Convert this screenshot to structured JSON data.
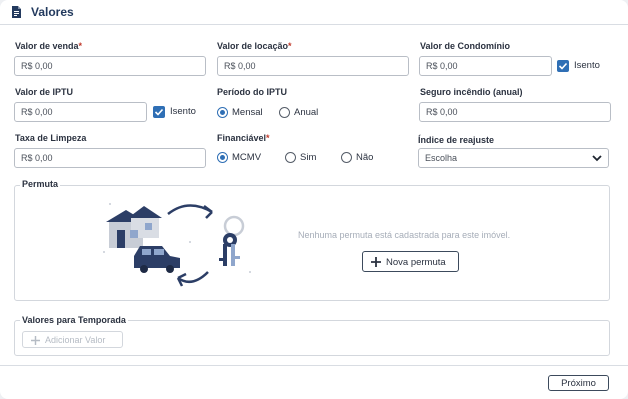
{
  "header": {
    "title": "Valores",
    "icon": "document-icon"
  },
  "fields": {
    "valor_venda": {
      "label": "Valor de venda",
      "required": "*",
      "value": "R$ 0,00"
    },
    "valor_locacao": {
      "label": "Valor de locação",
      "required": "*",
      "value": "R$ 0,00"
    },
    "valor_condominio": {
      "label": "Valor de Condomínio",
      "value": "R$ 0,00",
      "isento_label": "Isento",
      "isento_checked": true
    },
    "valor_iptu": {
      "label": "Valor de IPTU",
      "value": "R$ 0,00",
      "isento_label": "Isento",
      "isento_checked": true
    },
    "periodo_iptu": {
      "label": "Período do IPTU",
      "options": [
        "Mensal",
        "Anual"
      ],
      "selected": "Mensal"
    },
    "seguro_incendio": {
      "label": "Seguro incêndio (anual)",
      "value": "R$ 0,00"
    },
    "taxa_limpeza": {
      "label": "Taxa de Limpeza",
      "value": "R$ 0,00"
    },
    "financiavel": {
      "label": "Financiável",
      "required": "*",
      "options": [
        "MCMV",
        "Sim",
        "Não"
      ],
      "selected": "MCMV"
    },
    "indice_reajuste": {
      "label": "Índice de reajuste",
      "value": "Escolha"
    }
  },
  "permuta": {
    "legend": "Permuta",
    "empty_message": "Nenhuma permuta está cadastrada para este imóvel.",
    "button_label": "Nova permuta"
  },
  "temporada": {
    "legend": "Valores para Temporada",
    "button_label": "Adicionar Valor"
  },
  "footer": {
    "next_label": "Próximo"
  },
  "colors": {
    "accent": "#2f6fb5",
    "title": "#233a5e",
    "illustration_dark": "#2c3e66",
    "illustration_light": "#c8cdd6"
  }
}
